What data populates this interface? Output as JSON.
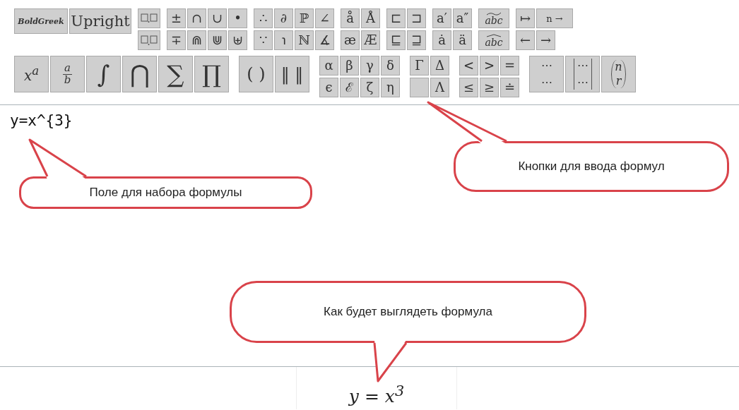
{
  "toolbar": {
    "bands": [
      {
        "groups": [
          {
            "kind": "words",
            "rows": [
              [
                {
                  "kind": "word_italic",
                  "label": "BoldGreek"
                },
                {
                  "kind": "word_upright",
                  "label": "Upright"
                }
              ]
            ]
          },
          {
            "kind": "grid",
            "rows": [
              [
                {
                  "kind": "boxes_upper"
                }
              ],
              [
                {
                  "kind": "boxes_lower"
                }
              ]
            ]
          },
          {
            "kind": "grid",
            "rows": [
              [
                {
                  "kind": "glyph",
                  "label": "±"
                },
                {
                  "kind": "glyph",
                  "label": "∩"
                },
                {
                  "kind": "glyph",
                  "label": "∪"
                },
                {
                  "kind": "glyph",
                  "label": "•"
                }
              ],
              [
                {
                  "kind": "glyph",
                  "label": "∓"
                },
                {
                  "kind": "glyph",
                  "label": "⋒"
                },
                {
                  "kind": "glyph",
                  "label": "⋓"
                },
                {
                  "kind": "glyph",
                  "label": "⊎"
                }
              ]
            ]
          },
          {
            "kind": "grid",
            "rows": [
              [
                {
                  "kind": "glyph",
                  "label": "∴"
                },
                {
                  "kind": "glyph",
                  "label": "∂"
                },
                {
                  "kind": "glyph",
                  "label": "ℙ"
                },
                {
                  "kind": "glyph",
                  "label": "∠"
                }
              ],
              [
                {
                  "kind": "glyph",
                  "label": "∵"
                },
                {
                  "kind": "glyph",
                  "label": "℩"
                },
                {
                  "kind": "glyph",
                  "label": "ℕ"
                },
                {
                  "kind": "glyph",
                  "label": "∡"
                }
              ]
            ]
          },
          {
            "kind": "grid",
            "rows": [
              [
                {
                  "kind": "glyph",
                  "label": "å"
                },
                {
                  "kind": "glyph",
                  "label": "Å"
                }
              ],
              [
                {
                  "kind": "glyph",
                  "label": "æ"
                },
                {
                  "kind": "glyph",
                  "label": "Æ"
                }
              ]
            ]
          },
          {
            "kind": "grid",
            "rows": [
              [
                {
                  "kind": "glyph",
                  "label": "⊏"
                },
                {
                  "kind": "glyph",
                  "label": "⊐"
                }
              ],
              [
                {
                  "kind": "glyph",
                  "label": "⊑"
                },
                {
                  "kind": "glyph",
                  "label": "⊒"
                }
              ]
            ]
          },
          {
            "kind": "grid",
            "rows": [
              [
                {
                  "kind": "glyph",
                  "label": "a′"
                },
                {
                  "kind": "glyph",
                  "label": "a″"
                }
              ],
              [
                {
                  "kind": "glyph",
                  "label": "ȧ"
                },
                {
                  "kind": "glyph",
                  "label": "ä"
                }
              ]
            ]
          },
          {
            "kind": "grid",
            "rows": [
              [
                {
                  "kind": "widetilde",
                  "label": "abc"
                }
              ],
              [
                {
                  "kind": "widehat",
                  "label": "abc"
                }
              ]
            ]
          },
          {
            "kind": "grid",
            "rows": [
              [
                {
                  "kind": "glyph",
                  "label": "↦"
                },
                {
                  "kind": "glyph",
                  "label": "n →"
                }
              ],
              [
                {
                  "kind": "glyph",
                  "label": "←"
                },
                {
                  "kind": "glyph",
                  "label": "→"
                }
              ]
            ]
          }
        ]
      },
      {
        "groups": [
          {
            "kind": "large",
            "rows": [
              [
                {
                  "kind": "power",
                  "label": "x$^{a}$"
                },
                {
                  "kind": "fraction",
                  "top": "a",
                  "bottom": "b"
                },
                {
                  "kind": "glyph",
                  "label": "∫"
                },
                {
                  "kind": "glyph",
                  "label": "⋂"
                },
                {
                  "kind": "glyph",
                  "label": "∑"
                },
                {
                  "kind": "glyph",
                  "label": "∏"
                }
              ]
            ]
          },
          {
            "kind": "large",
            "rows": [
              [
                {
                  "kind": "glyph",
                  "label": "( )"
                },
                {
                  "kind": "glyph",
                  "label": "‖ ‖"
                }
              ]
            ]
          },
          {
            "kind": "grid",
            "rows": [
              [
                {
                  "kind": "glyph",
                  "label": "α"
                },
                {
                  "kind": "glyph",
                  "label": "β"
                },
                {
                  "kind": "glyph",
                  "label": "γ"
                },
                {
                  "kind": "glyph",
                  "label": "δ"
                }
              ],
              [
                {
                  "kind": "glyph",
                  "label": "ϵ"
                },
                {
                  "kind": "glyph",
                  "label": "ℰ"
                },
                {
                  "kind": "glyph",
                  "label": "ζ"
                },
                {
                  "kind": "glyph",
                  "label": "η"
                }
              ]
            ]
          },
          {
            "kind": "grid",
            "rows": [
              [
                {
                  "kind": "glyph",
                  "label": "Γ"
                },
                {
                  "kind": "glyph",
                  "label": "Δ"
                }
              ],
              [
                {
                  "kind": "blank"
                },
                {
                  "kind": "glyph",
                  "label": "Λ"
                }
              ]
            ]
          },
          {
            "kind": "grid",
            "rows": [
              [
                {
                  "kind": "glyph",
                  "label": "<"
                },
                {
                  "kind": "glyph",
                  "label": ">"
                },
                {
                  "kind": "glyph",
                  "label": "="
                }
              ],
              [
                {
                  "kind": "glyph",
                  "label": "≤"
                },
                {
                  "kind": "glyph",
                  "label": "≥"
                },
                {
                  "kind": "glyph",
                  "label": "≐"
                }
              ]
            ]
          },
          {
            "kind": "large",
            "rows": [
              [
                {
                  "kind": "stack",
                  "lines": [
                    "⋯",
                    "⋯"
                  ]
                },
                {
                  "kind": "bracket_stack",
                  "lines": [
                    "⋯",
                    "⋯"
                  ]
                },
                {
                  "kind": "binomial",
                  "top": "n",
                  "bottom": "r"
                }
              ]
            ]
          }
        ]
      }
    ]
  },
  "editor": {
    "value": "y=x^{3}"
  },
  "preview": {
    "formula": "y = x$^{3}$"
  },
  "callouts": [
    {
      "text": "Кнопки для ввода формул"
    },
    {
      "text": "Поле для набора формулы"
    },
    {
      "text": "Как будет выглядеть формула"
    }
  ]
}
